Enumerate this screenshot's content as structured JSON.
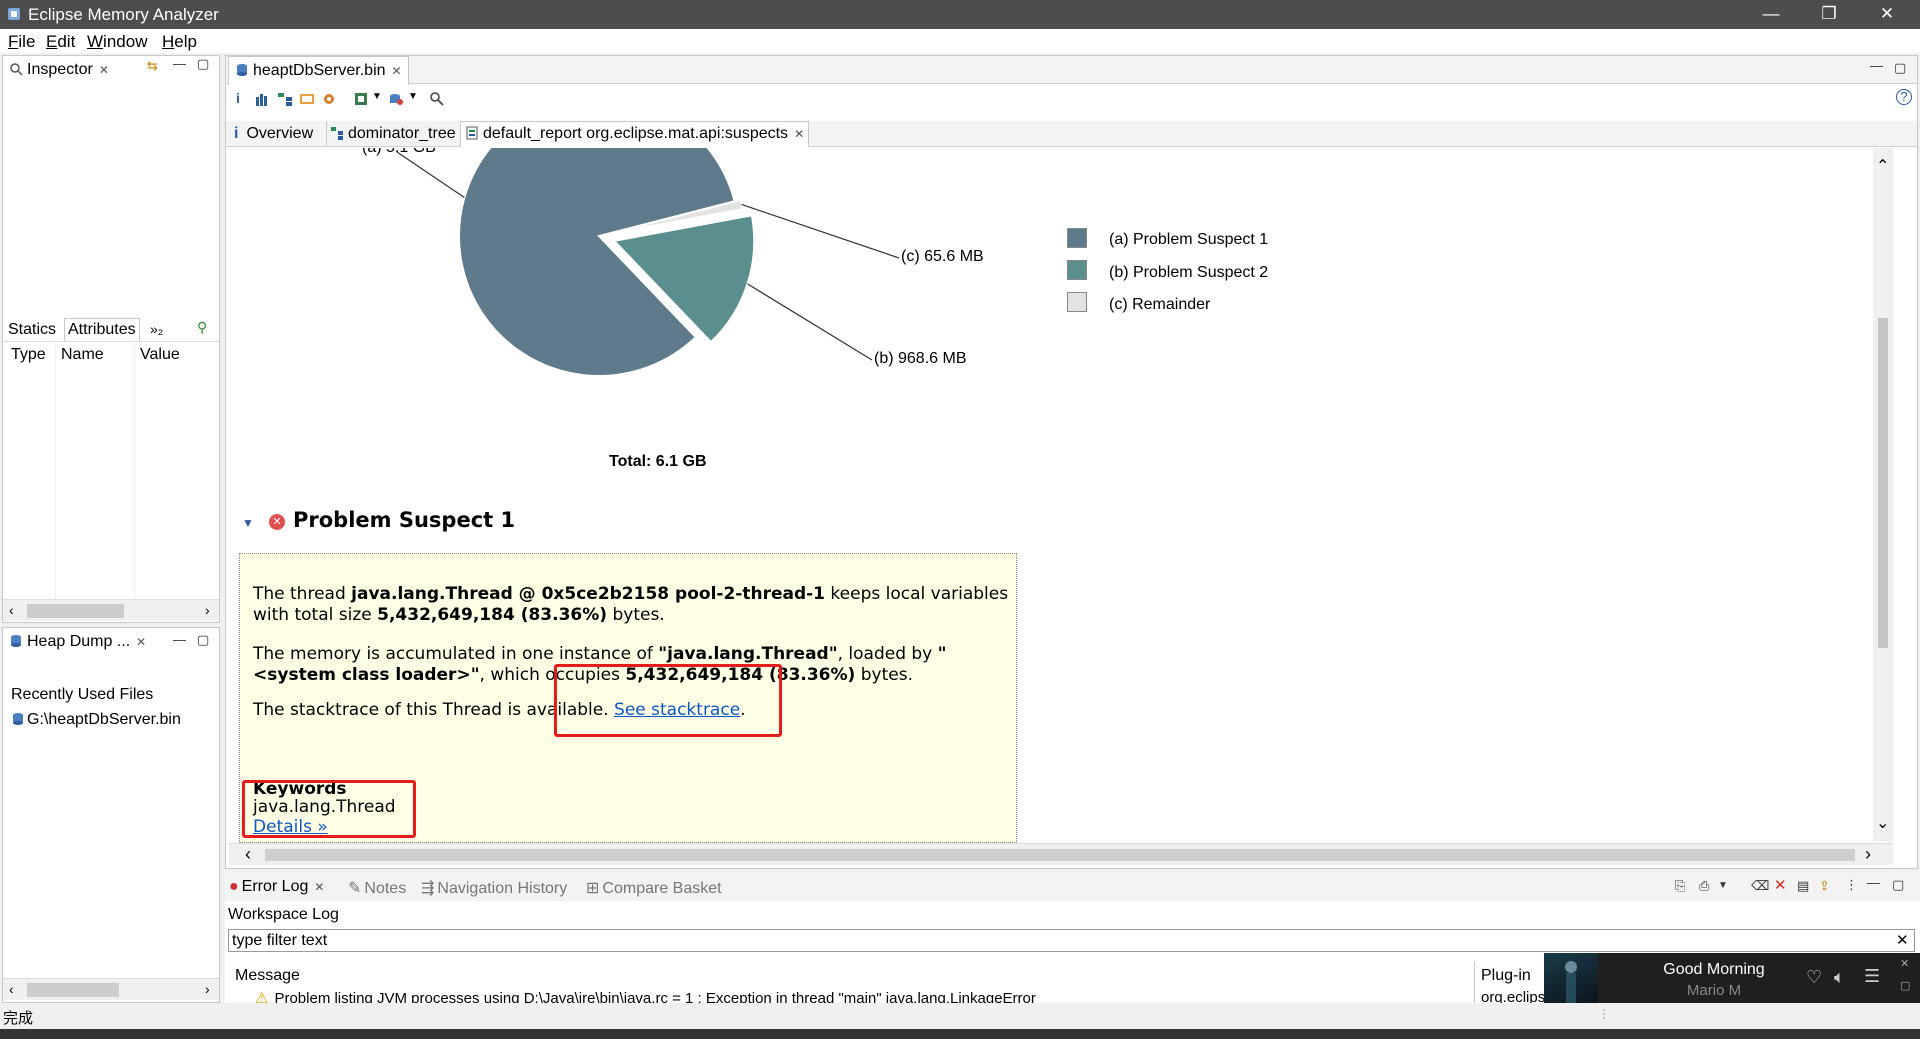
{
  "window": {
    "title": "Eclipse Memory Analyzer",
    "minimize_glyph": "—",
    "restore_glyph": "❐",
    "close_glyph": "✕"
  },
  "menu": [
    "File",
    "Edit",
    "Window",
    "Help"
  ],
  "inspector": {
    "tab_label": "Inspector",
    "subtabs": [
      "Statics",
      "Attributes",
      "»₂"
    ],
    "columns": [
      "Type",
      "Name",
      "Value"
    ]
  },
  "heapdump": {
    "tab_label": "Heap Dump ...",
    "recent_title": "Recently Used Files",
    "recent_file": "G:\\heaptDbServer.bin"
  },
  "editor": {
    "tab_label": "heaptDbServer.bin",
    "subtabs": {
      "overview": "Overview",
      "dominator": "dominator_tree",
      "report": "default_report  org.eclipse.mat.api:suspects"
    }
  },
  "chart_data": {
    "type": "pie",
    "total_label": "Total: 6.1 GB",
    "slices": [
      {
        "key": "(a)",
        "name": "Problem Suspect 1",
        "label": "(a)  5.1 GB",
        "value_gb": 5.1,
        "color": "#5f7a8b"
      },
      {
        "key": "(b)",
        "name": "Problem Suspect 2",
        "label": "(b)  968.6 MB",
        "value_gb": 0.9686,
        "color": "#5b8f8d"
      },
      {
        "key": "(c)",
        "name": "Remainder",
        "label": "(c)  65.6 MB",
        "value_gb": 0.0656,
        "color": "#e3e3e3"
      }
    ],
    "legend": [
      "(a)  Problem Suspect 1",
      "(b)  Problem Suspect 2",
      "(c)  Remainder"
    ]
  },
  "suspect": {
    "heading": "Problem Suspect 1",
    "p1_a": "The thread ",
    "p1_b": "java.lang.Thread @ 0x5ce2b2158 pool-2-thread-1",
    "p1_c": " keeps local variables with total size ",
    "p1_d": "5,432,649,184 (83.36%)",
    "p1_e": " bytes.",
    "p2_a": "The memory is accumulated in one instance of ",
    "p2_b": "\"java.lang.Thread\"",
    "p2_c": ", loaded by ",
    "p2_d": "\"<system class loader>\"",
    "p2_e": ", which occupies ",
    "p2_f": "5,432,649,184 (83.36%)",
    "p2_g": " bytes.",
    "p3_a": "The stacktrace of this Thread is available. ",
    "p3_link": "See stacktrace",
    "p3_end": ".",
    "keywords_title": "Keywords",
    "keyword": "java.lang.Thread",
    "details_link": "Details »"
  },
  "log": {
    "tabs": [
      "Error Log",
      "Notes",
      "Navigation History",
      "Compare Basket"
    ],
    "workspace": "Workspace Log",
    "filter_placeholder": "type filter text",
    "col_message": "Message",
    "col_plugin": "Plug-in",
    "row_message": "Problem listing JVM processes using D:\\Java\\jre\\bin\\java.rc = 1 : Exception in thread \"main\" java.lang.LinkageError",
    "row_plugin": "org.eclips"
  },
  "status": {
    "text": "完成"
  },
  "media": {
    "song": "Good Morning",
    "artist": "Mario M"
  },
  "colors": {
    "accent_red": "#e51c1c",
    "link": "#0b56c4",
    "suspect_bg": "#ffffe5"
  }
}
